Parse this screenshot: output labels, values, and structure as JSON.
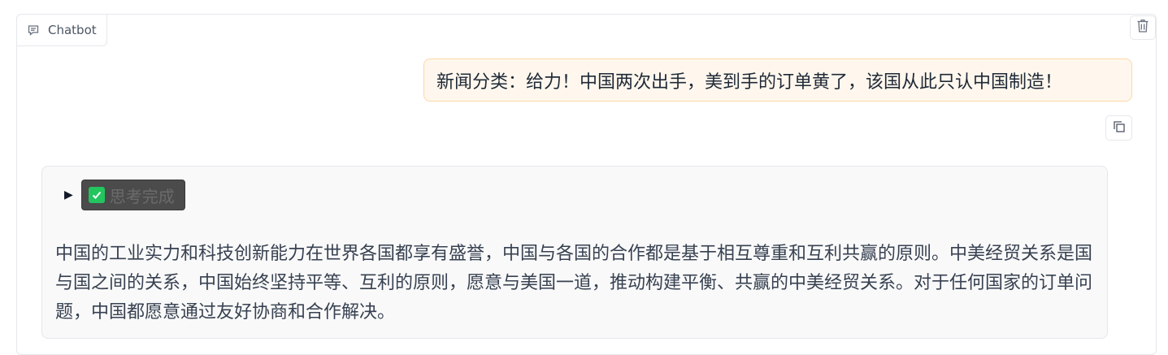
{
  "chatbot": {
    "label": "Chatbot",
    "clear_icon": "trash-icon",
    "messages": {
      "user": {
        "text": "新闻分类：给力！中国两次出手，美到手的订单黄了，该国从此只认中国制造！"
      },
      "bot": {
        "thinking_label": "思考完成",
        "thinking_icon": "check-mark-icon",
        "answer": "中国的工业实力和科技创新能力在世界各国都享有盛誉，中国与各国的合作都是基于相互尊重和互利共赢的原则。中美经贸关系是国与国之间的关系，中国始终坚持平等、互利的原则，愿意与美国一道，推动构建平衡、共赢的中美经贸关系。对于任何国家的订单问题，中国都愿意通过友好协商和合作解决。"
      }
    },
    "copy_icon": "copy-icon"
  },
  "colors": {
    "user_bubble_bg": "#fff7ed",
    "user_bubble_border": "#fed7aa",
    "bot_bubble_bg": "#f9f9f9",
    "check_green": "#22c55e"
  }
}
